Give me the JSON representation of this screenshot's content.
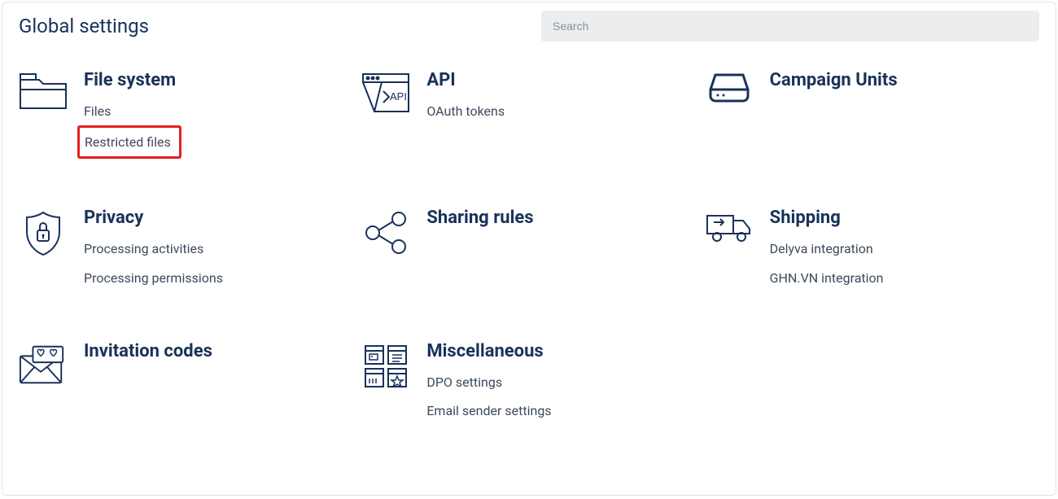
{
  "header": {
    "title": "Global settings",
    "search_placeholder": "Search"
  },
  "sections": {
    "file_system": {
      "title": "File system",
      "links": {
        "files": "Files",
        "restricted": "Restricted files"
      }
    },
    "api": {
      "title": "API",
      "links": {
        "oauth": "OAuth tokens"
      }
    },
    "campaign": {
      "title": "Campaign Units"
    },
    "privacy": {
      "title": "Privacy",
      "links": {
        "activities": "Processing activities",
        "permissions": "Processing permissions"
      }
    },
    "sharing": {
      "title": "Sharing rules"
    },
    "shipping": {
      "title": "Shipping",
      "links": {
        "delyva": "Delyva integration",
        "ghn": "GHN.VN integration"
      }
    },
    "invitation": {
      "title": "Invitation codes"
    },
    "misc": {
      "title": "Miscellaneous",
      "links": {
        "dpo": "DPO settings",
        "email": "Email sender settings"
      }
    }
  },
  "icons": {
    "api_label": "API"
  }
}
